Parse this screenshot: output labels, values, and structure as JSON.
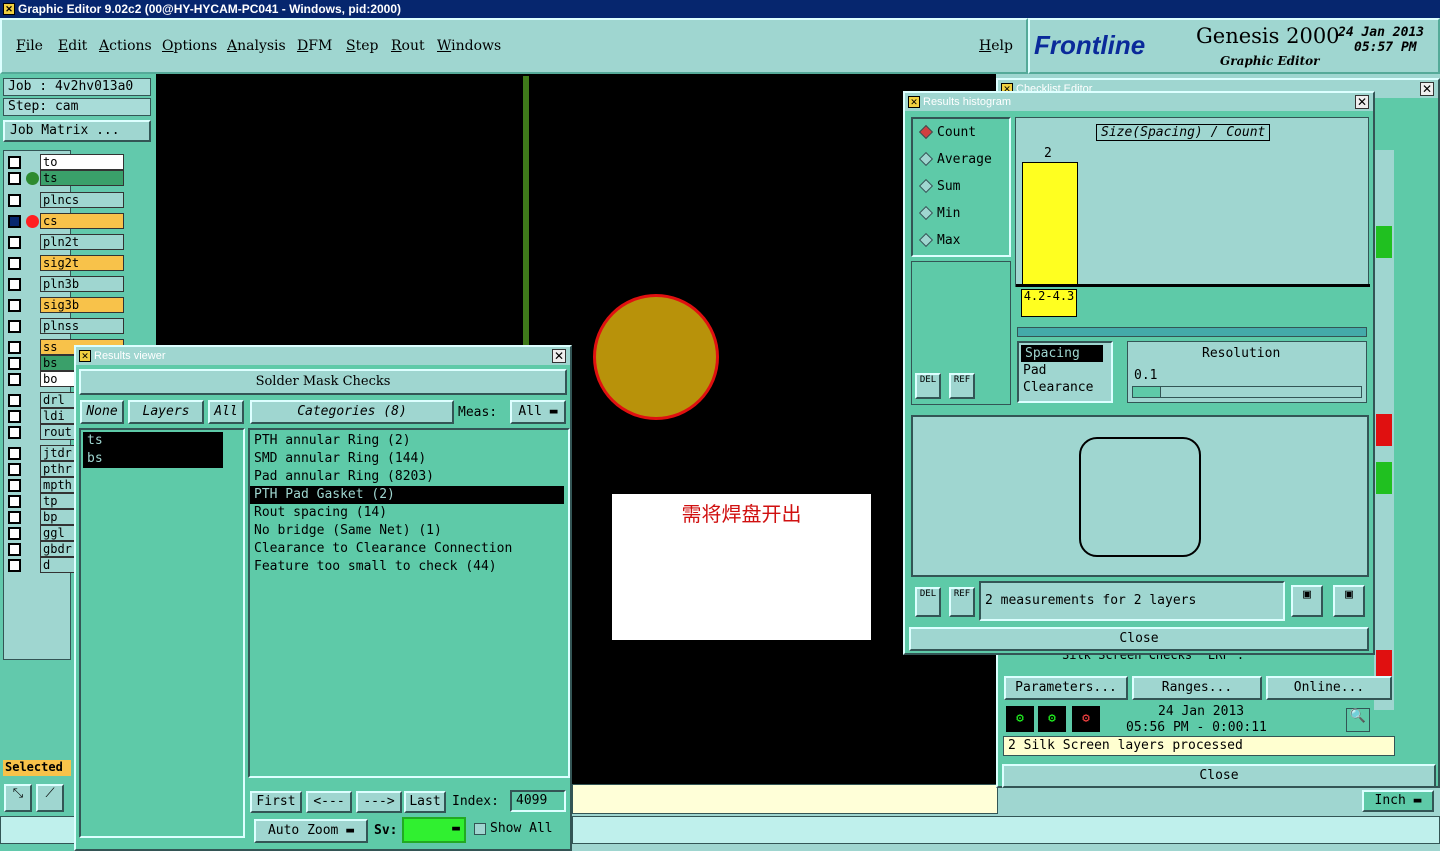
{
  "window": {
    "title": "Graphic Editor 9.02c2 (00@HY-HYCAM-PC041 - Windows, pid:2000)"
  },
  "menu": [
    "File",
    "Edit",
    "Actions",
    "Options",
    "Analysis",
    "DFM",
    "Step",
    "Rout",
    "Windows"
  ],
  "help_label": "Help",
  "brand": {
    "logo": "Frontline",
    "product": "Genesis 2000",
    "subtitle": "Graphic Editor",
    "date": "24 Jan 2013",
    "time": "05:57 PM"
  },
  "job": {
    "job_label": "Job : 4v2hv013a0",
    "step_label": "Step: cam",
    "matrix_button": "Job Matrix ..."
  },
  "layers": [
    {
      "name": "to",
      "color": "#ffffff",
      "dot": ""
    },
    {
      "name": "ts",
      "color": "#3aa06a",
      "dot": "#2e8b30"
    },
    {
      "name": "plncs",
      "color": "#9fd6d0",
      "dot": ""
    },
    {
      "name": "cs",
      "color": "#f8c24a",
      "dot": "#ff2020"
    },
    {
      "name": "pln2t",
      "color": "#9fd6d0",
      "dot": ""
    },
    {
      "name": "sig2t",
      "color": "#f8c24a",
      "dot": ""
    },
    {
      "name": "pln3b",
      "color": "#9fd6d0",
      "dot": ""
    },
    {
      "name": "sig3b",
      "color": "#f8c24a",
      "dot": ""
    },
    {
      "name": "plnss",
      "color": "#9fd6d0",
      "dot": ""
    },
    {
      "name": "ss",
      "color": "#f8c24a",
      "dot": ""
    },
    {
      "name": "bs",
      "color": "#3aa06a",
      "dot": ""
    },
    {
      "name": "bo",
      "color": "#ffffff",
      "dot": ""
    },
    {
      "name": "drl",
      "color": "#9fd6d0",
      "dot": ""
    },
    {
      "name": "ldi",
      "color": "#9fd6d0",
      "dot": ""
    },
    {
      "name": "rout",
      "color": "#9fd6d0",
      "dot": ""
    },
    {
      "name": "jtdr",
      "color": "#9fd6d0",
      "dot": ""
    },
    {
      "name": "pthr",
      "color": "#9fd6d0",
      "dot": ""
    },
    {
      "name": "mpth",
      "color": "#9fd6d0",
      "dot": ""
    },
    {
      "name": "tp",
      "color": "#9fd6d0",
      "dot": ""
    },
    {
      "name": "bp",
      "color": "#9fd6d0",
      "dot": ""
    },
    {
      "name": "ggl",
      "color": "#9fd6d0",
      "dot": ""
    },
    {
      "name": "gbdr",
      "color": "#9fd6d0",
      "dot": ""
    },
    {
      "name": "d",
      "color": "#9fd6d0",
      "dot": ""
    }
  ],
  "selected_label": "Selected",
  "note_text": "需将焊盘开出",
  "results_viewer": {
    "title": "Results viewer",
    "header": "Solder Mask Checks",
    "none_btn": "None",
    "layers_btn": "Layers",
    "all_btn": "All",
    "categories_btn": "Categories (8)",
    "meas_label": "Meas:",
    "meas_value": "All",
    "layer_items": [
      "ts",
      "bs"
    ],
    "categories": [
      "PTH annular Ring (2)",
      "SMD annular Ring (144)",
      "Pad annular Ring (8203)",
      "PTH Pad Gasket (2)",
      "Rout spacing (14)",
      "No bridge (Same Net) (1)",
      "Clearance to Clearance Connection",
      "Feature too small to check (44)"
    ],
    "first_btn": "First",
    "prev_btn": "<---",
    "next_btn": "--->",
    "last_btn": "Last",
    "index_label": "Index:",
    "index_value": "4099",
    "auto_zoom": "Auto Zoom",
    "sv_label": "Sv:",
    "show_all": "Show All"
  },
  "histogram": {
    "title": "Results histogram",
    "modes": [
      "Count",
      "Average",
      "Sum",
      "Min",
      "Max"
    ],
    "chart_title": "Size(Spacing) / Count",
    "bar_value": "2",
    "bar_label": "4.2-4.3",
    "props": [
      "Spacing",
      "Pad",
      "Clearance"
    ],
    "resolution_label": "Resolution",
    "resolution_value": "0.1",
    "del": "DEL",
    "ref": "REF",
    "measurements": "2 measurements for 2 layers",
    "close": "Close"
  },
  "checklist": {
    "title": "Checklist Editor",
    "row_name": "Silk Screen Checks",
    "row_field": "ERF :",
    "parameters": "Parameters...",
    "ranges": "Ranges...",
    "online": "Online...",
    "date": "24 Jan 2013",
    "time": "05:56 PM - 0:00:11",
    "status": "2 Silk Screen layers processed",
    "close": "Close"
  },
  "units": "Inch",
  "colors": {
    "canvas": "#000000",
    "panel": "#5ecaa8",
    "pad": "#b8920a",
    "pad_ring": "#e01010",
    "bar": "#ffff20"
  }
}
